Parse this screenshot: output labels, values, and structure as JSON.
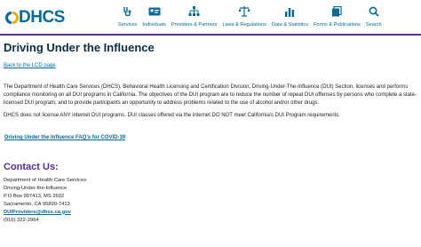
{
  "header": {
    "logo_text": "DHCS",
    "nav": [
      {
        "label": "Services",
        "icon": "stethoscope-icon"
      },
      {
        "label": "Individuals",
        "icon": "id-card-icon"
      },
      {
        "label": "Providers & Partners",
        "icon": "org-chart-icon"
      },
      {
        "label": "Laws & Regulations",
        "icon": "scales-icon"
      },
      {
        "label": "Data & Statistics",
        "icon": "bar-chart-icon"
      },
      {
        "label": "Forms & Publications",
        "icon": "documents-icon"
      },
      {
        "label": "Search",
        "icon": "search-icon"
      }
    ]
  },
  "colors": {
    "brand": "#046b99",
    "accent": "#5c2d91",
    "heading": "#0b2e44"
  },
  "page": {
    "title": "Driving Under the Influence",
    "back_link": "Back to the LCD page",
    "paragraph1": "The Department of Health Care Services (DHCS), Behavioral Health Licensing and Certification Division, Driving-Under-The-Influence (DUI) Section, licenses and performs compliance monitoring on all DUI programs in California. The objectives of the DUI program are to reduce the number of repeat DUI offenses by persons who complete a state-licensed DUI program; and to provide participants an opportunity to address problems related to the use of alcohol and/or other drugs.",
    "paragraph2": "DHCS does not license ANY internet DUI programs.  DUI classes offered via the internet DO NOT meet California's DUI Program requirements.",
    "faq_link": "Driving Under the Influence FAQ's for COVID-19"
  },
  "contact": {
    "heading": "Contact Us:",
    "line1": "Department of Health Care Services",
    "line2": "Driving-Under-the-Influence",
    "line3": "P.O Box 997413, MS 2602",
    "line4": "Sacramento, CA 95899-7413",
    "email": "DUIProviders@dhcs.ca.gov",
    "phone": "(916) 322-2964"
  }
}
